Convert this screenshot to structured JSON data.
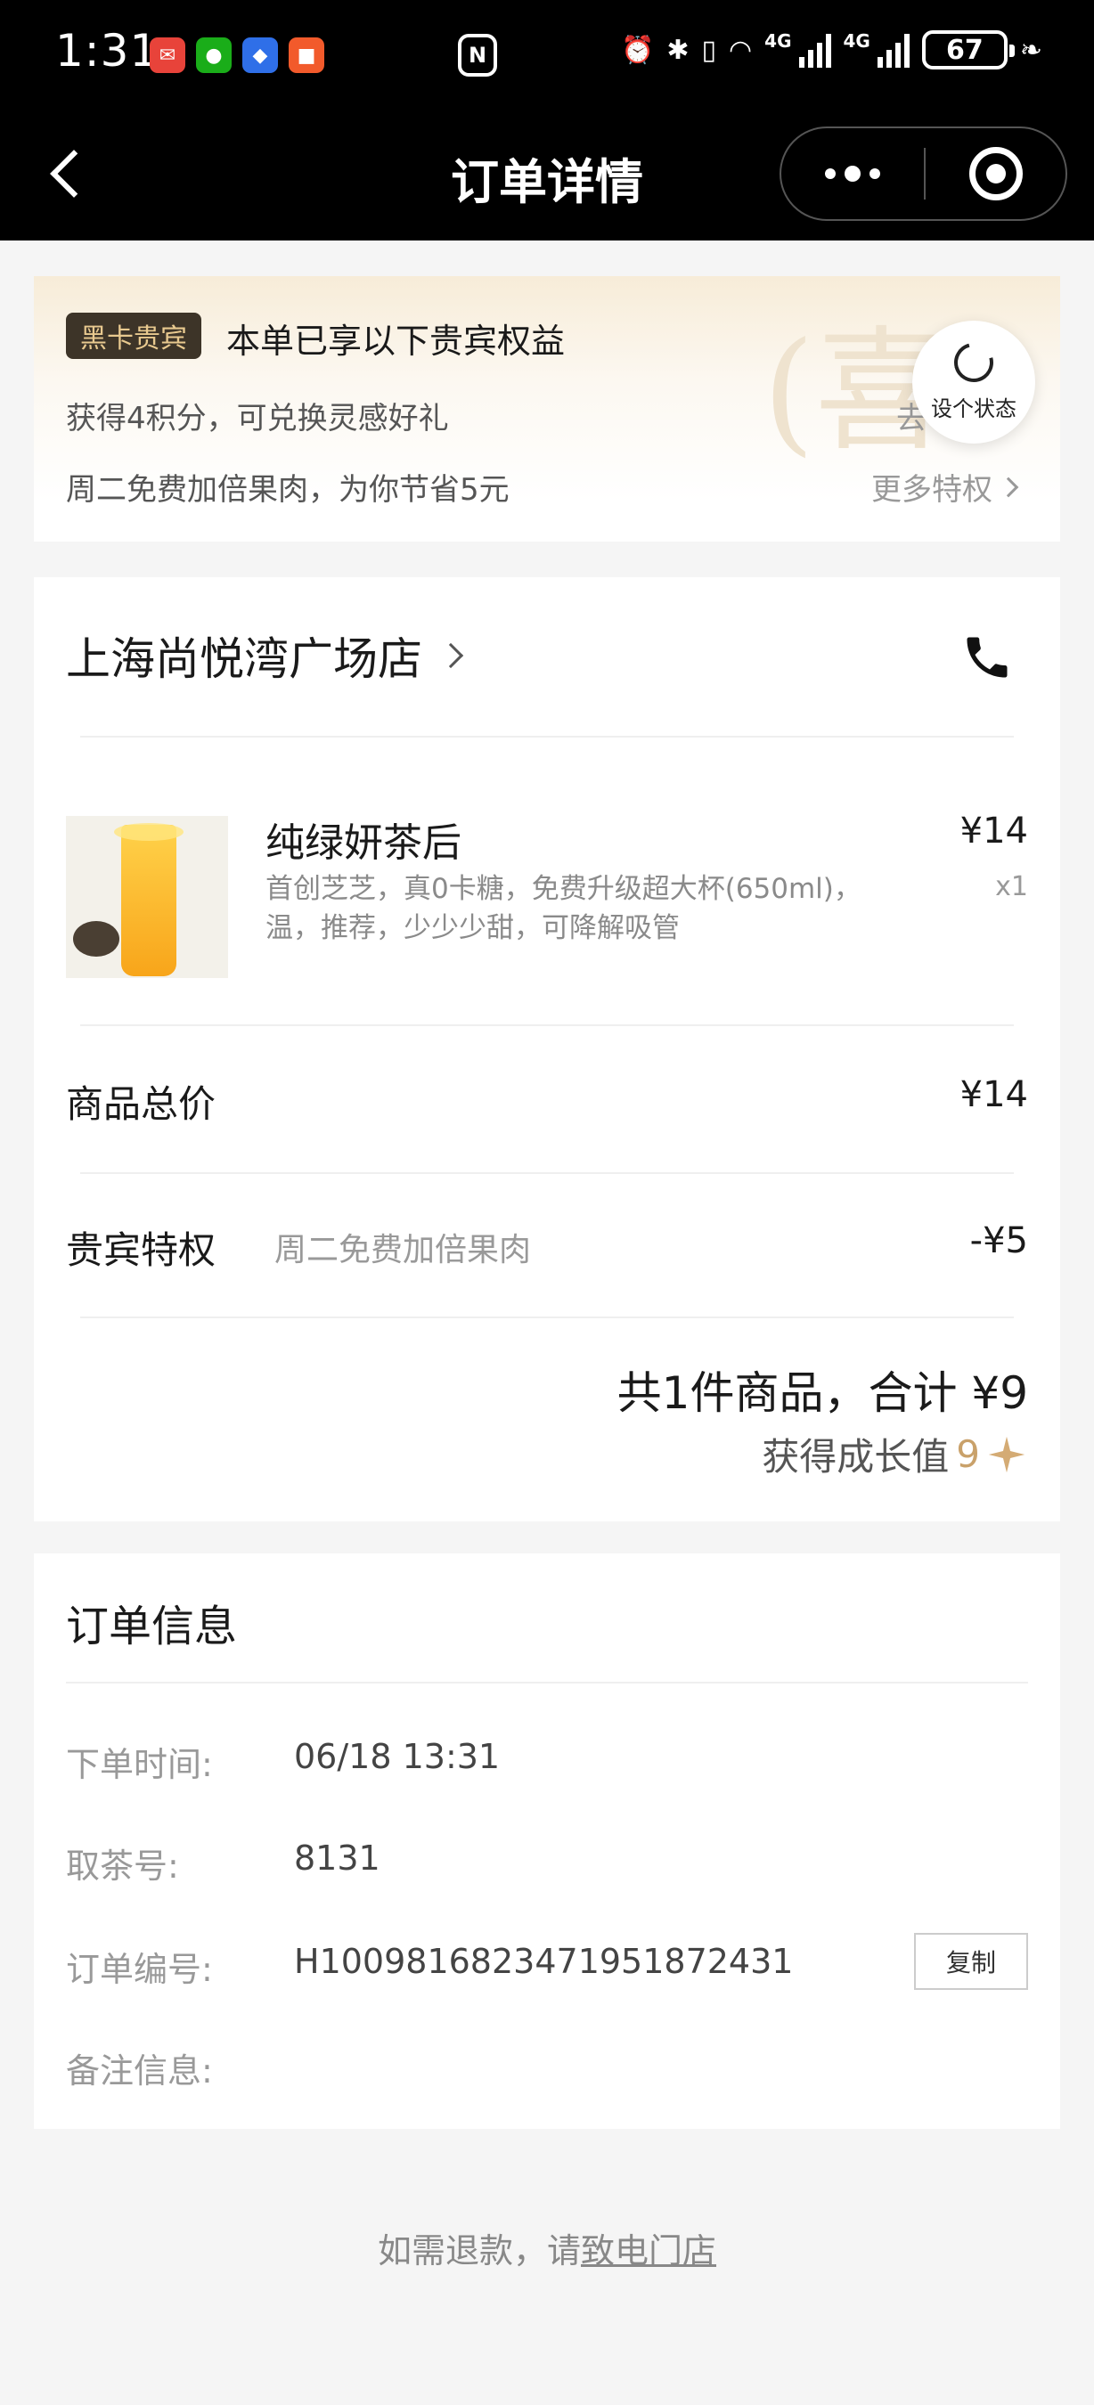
{
  "status_bar": {
    "time": "1:31",
    "battery": "67",
    "network_1": "4G",
    "network_2": "4G"
  },
  "nav": {
    "title": "订单详情"
  },
  "vip": {
    "badge": "黑卡贵宾",
    "headline": "本单已享以下贵宾权益",
    "line1": "获得4积分，可兑换灵感好礼",
    "go": "去",
    "line2": "周二免费加倍果肉，为你节省5元",
    "more": "更多特权",
    "watermark": "(喜",
    "status_bubble": "设个状态"
  },
  "order": {
    "store_name": "上海尚悦湾广场店",
    "product": {
      "name": "纯绿妍茶后",
      "desc": "首创芝芝，真0卡糖，免费升级超大杯(650ml)，温，推荐，少少少甜，可降解吸管",
      "price": "¥14",
      "qty": "x1"
    },
    "subtotal_label": "商品总价",
    "subtotal_value": "¥14",
    "privilege_label": "贵宾特权",
    "privilege_desc": "周二免费加倍果肉",
    "privilege_value": "-¥5",
    "total": "共1件商品，合计 ¥9",
    "growth_label": "获得成长值",
    "growth_value": "9"
  },
  "info": {
    "title": "订单信息",
    "time_label": "下单时间:",
    "time_value": "06/18 13:31",
    "pickup_label": "取茶号:",
    "pickup_value": "8131",
    "order_no_label": "订单编号:",
    "order_no_value": "H1009816823471951872431",
    "copy_label": "复制",
    "remark_label": "备注信息:"
  },
  "footer": {
    "refund_prefix": "如需退款，请",
    "refund_link": "致电门店"
  },
  "colors": {
    "accent_gold": "#c9a16a",
    "badge_bg": "#3d3428",
    "badge_text": "#e8c98f"
  }
}
